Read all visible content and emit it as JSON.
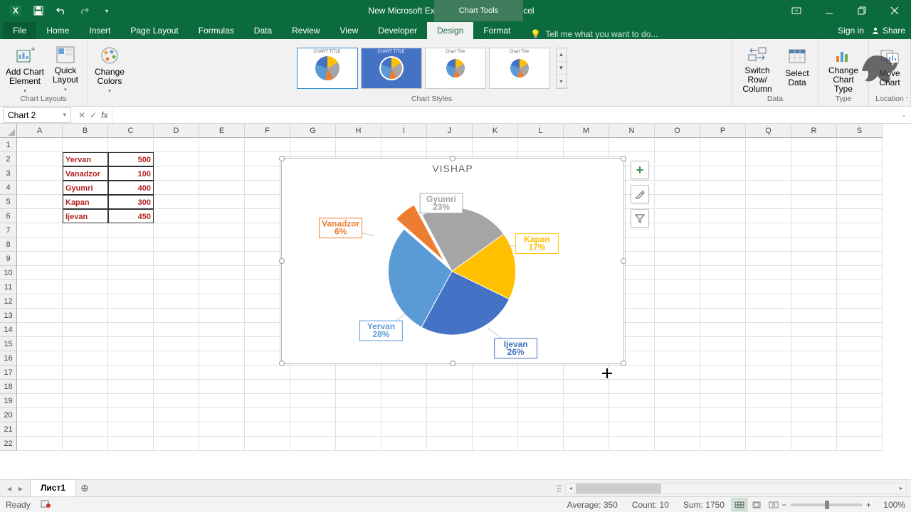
{
  "app": {
    "title": "New Microsoft Excel Worksheet.xlsx - Excel",
    "chart_tools_label": "Chart Tools",
    "signin": "Sign in",
    "share": "Share",
    "tell_me": "Tell me what you want to do..."
  },
  "tabs": [
    "File",
    "Home",
    "Insert",
    "Page Layout",
    "Formulas",
    "Data",
    "Review",
    "View",
    "Developer",
    "Design",
    "Format"
  ],
  "active_tab": "Design",
  "ribbon": {
    "chart_layouts": "Chart Layouts",
    "add_element": "Add Chart Element",
    "quick_layout": "Quick Layout",
    "change_colors": "Change Colors",
    "chart_styles": "Chart Styles",
    "data": "Data",
    "switch": "Switch Row/ Column",
    "select_data": "Select Data",
    "type": "Type",
    "change_type": "Change Chart Type",
    "location": "Location",
    "move_chart": "Move Chart"
  },
  "namebox": "Chart 2",
  "columns": [
    "A",
    "B",
    "C",
    "D",
    "E",
    "F",
    "G",
    "H",
    "I",
    "J",
    "K",
    "L",
    "M",
    "N",
    "O",
    "P",
    "Q",
    "R",
    "S"
  ],
  "rows": 22,
  "table": [
    {
      "b": "Yervan",
      "c": "500"
    },
    {
      "b": "Vanadzor",
      "c": "100"
    },
    {
      "b": "Gyumri",
      "c": "400"
    },
    {
      "b": "Kapan",
      "c": "300"
    },
    {
      "b": "Ijevan",
      "c": "450"
    }
  ],
  "chart_data": {
    "type": "pie",
    "title": "VISHAP",
    "categories": [
      "Yervan",
      "Vanadzor",
      "Gyumri",
      "Kapan",
      "Ijevan"
    ],
    "values": [
      500,
      100,
      400,
      300,
      450
    ],
    "percentages": [
      28,
      6,
      23,
      17,
      26
    ],
    "colors": [
      "#5b9bd5",
      "#ed7d31",
      "#a5a5a5",
      "#ffc000",
      "#4472c4"
    ],
    "exploded": [
      "Vanadzor"
    ]
  },
  "sheet": "Лист1",
  "status": {
    "ready": "Ready",
    "average_label": "Average:",
    "average": "350",
    "count_label": "Count:",
    "count": "10",
    "sum_label": "Sum:",
    "sum": "1750",
    "zoom": "100%"
  }
}
